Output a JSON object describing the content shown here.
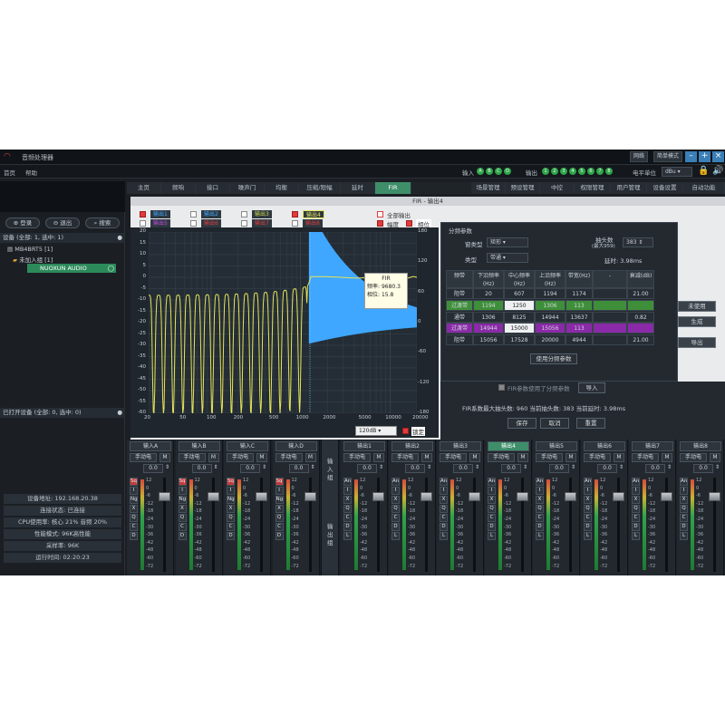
{
  "app": {
    "title": "音频处理器"
  },
  "titlebar": {
    "buttons": [
      "网络",
      "简单模式"
    ]
  },
  "menu": {
    "items": [
      "首页",
      "帮助"
    ]
  },
  "io": {
    "input_label": "输入",
    "inputs": [
      "A",
      "B",
      "C",
      "D"
    ],
    "output_label": "输出",
    "outputs": [
      "1",
      "2",
      "3",
      "4",
      "5",
      "6",
      "7",
      "8"
    ],
    "level_label": "电平单位",
    "level_unit": "dBu"
  },
  "tabs": [
    "主页",
    "频响",
    "接口",
    "噪声门",
    "均衡",
    "压缩/限幅",
    "延时",
    "FIR",
    "场景管理",
    "预设管理",
    "中控",
    "权限管理",
    "用户管理",
    "设备设置",
    "自动功能"
  ],
  "active_tab": "FIR",
  "left": {
    "login": "登录",
    "logout": "退出",
    "search": "搜索",
    "devices_head": "设备 (全部: 1, 选中: 1)",
    "tree": [
      "MB4BRT5 [1]",
      "未加入组 [1]",
      "NUOXUN AUDIO"
    ],
    "opened_head": "已打开设备 (全部: 0, 选中: 0)",
    "info": [
      "设备地址: 192.168.20.38",
      "连接状态: 已连接",
      "CPU使用率: 核心 21% 音频 20%",
      "性能模式: 96K高性能",
      "采样率: 96K",
      "运行时间: 02:20:23"
    ]
  },
  "dialog": {
    "title": "FIR - 输出4",
    "channels": [
      {
        "label": "输出1",
        "checked": true,
        "color": "#3fa7ff"
      },
      {
        "label": "输出2",
        "checked": false,
        "color": "#3fa7ff"
      },
      {
        "label": "输出3",
        "checked": false,
        "color": "#c8d64a"
      },
      {
        "label": "输出4",
        "checked": true,
        "color": "#e6e35a"
      },
      {
        "label": "输出5",
        "checked": false,
        "color": "#c44be0"
      },
      {
        "label": "输出6",
        "checked": false,
        "color": "#e23b3b"
      },
      {
        "label": "输出7",
        "checked": false,
        "color": "#e23b3b"
      },
      {
        "label": "输出8",
        "checked": false,
        "color": "#e23b3b"
      }
    ],
    "all_output": "全部输出",
    "amp_label": "幅度",
    "phase_label": "相位",
    "yticks_left": [
      "20",
      "15",
      "10",
      "5",
      "0",
      "-5",
      "-10",
      "-15",
      "-20",
      "-25",
      "-30",
      "-35",
      "-40",
      "-45",
      "-50",
      "-55",
      "-60"
    ],
    "yticks_right": [
      "180",
      "120",
      "60",
      "0",
      "-60",
      "-120",
      "-180"
    ],
    "xticks": [
      "20",
      "50",
      "100",
      "200",
      "500",
      "1000",
      "2000",
      "5000",
      "10000",
      "20000"
    ],
    "tooltip": {
      "title": "FIR",
      "freq_label": "频率:",
      "freq": "9680.3",
      "phase_label": "相位:",
      "phase": "15.8"
    },
    "range": "120dB",
    "lock": "锁定",
    "panel": {
      "title": "分频参数",
      "window_label": "窗类型",
      "window": "矩形",
      "type_label": "类型",
      "type": "带通",
      "taps_label": "抽头数",
      "taps_sub": "(最大959)",
      "taps": "383",
      "delay": "延时: 3.98ms",
      "headers": [
        "频带",
        "下沿频率(Hz)",
        "中心频率(Hz)",
        "上沿频率(Hz)",
        "带宽(Hz)",
        "-",
        "衰减(dB)"
      ],
      "rows": [
        [
          "阻带",
          "20",
          "607",
          "1194",
          "1174",
          "",
          "21.00"
        ],
        [
          "过渡带",
          "1194",
          "1250",
          "1306",
          "113",
          "",
          ""
        ],
        [
          "通带",
          "1306",
          "8125",
          "14944",
          "13637",
          "",
          "0.82"
        ],
        [
          "过渡带",
          "14944",
          "15000",
          "15056",
          "113",
          "",
          ""
        ],
        [
          "阻带",
          "15056",
          "17528",
          "20000",
          "4944",
          "",
          "21.00"
        ]
      ],
      "use_btn": "使用分频参数"
    },
    "side_buttons": [
      "未使用",
      "生成",
      "导出"
    ],
    "fir_use_label": "FIR参数使用了分频参数",
    "import": "导入",
    "fir_status": "FIR系数最大抽头数: 960  当前抽头数: 383  当前延时: 3.98ms",
    "save": "保存",
    "cancel": "取消",
    "reset": "重置"
  },
  "mixer": {
    "inputs": [
      "输入A",
      "输入B",
      "输入C",
      "输入D"
    ],
    "outputs": [
      "输出1",
      "输出2",
      "输出3",
      "输出4",
      "输出5",
      "输出6",
      "输出7",
      "输出8"
    ],
    "active_output": "输出4",
    "mode": "手动电",
    "m": "M",
    "gain": "0.0",
    "side_in": "输入组",
    "side_out": "输出组",
    "in_keys": [
      "Sq",
      "I",
      "Ng",
      "X",
      "Q",
      "C",
      "D"
    ],
    "out_keys": [
      "An",
      "I",
      "X",
      "Q",
      "C",
      "D",
      "L"
    ],
    "scale": [
      "12",
      "0",
      "-6",
      "-12",
      "-18",
      "-24",
      "-30",
      "-36",
      "-42",
      "-48",
      "-60",
      "-72"
    ]
  },
  "colors": {
    "accent": "#3e8e6a",
    "amp_curve": "#e6e35a",
    "phase_curve": "#3fa7ff",
    "trans_band": "#3f8f3a",
    "trans_band2": "#8a2aa8"
  }
}
